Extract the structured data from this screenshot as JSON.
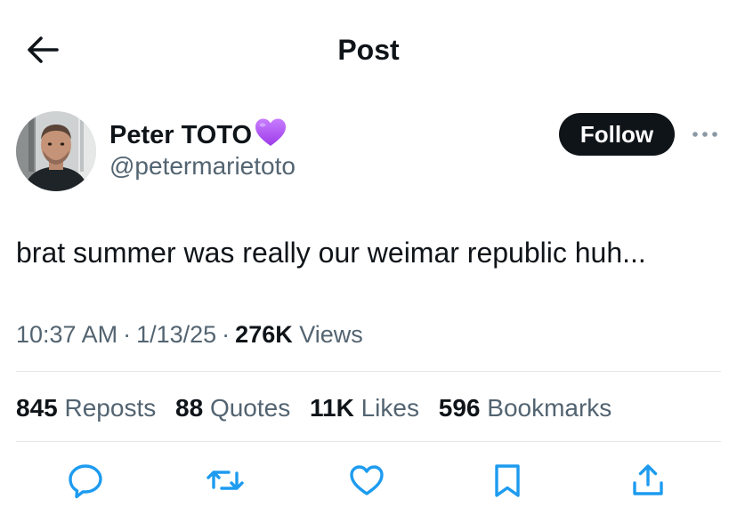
{
  "header": {
    "title": "Post"
  },
  "author": {
    "display_name": "Peter TOTO",
    "handle": "@petermarietoto",
    "badge_emoji": "purple-heart",
    "follow_label": "Follow"
  },
  "tweet": {
    "text": "brat summer was really our weimar republic huh...",
    "time": "10:37 AM",
    "date": "1/13/25",
    "views_count": "276K",
    "views_label": "Views"
  },
  "stats": {
    "reposts": {
      "count": "845",
      "label": "Reposts"
    },
    "quotes": {
      "count": "88",
      "label": "Quotes"
    },
    "likes": {
      "count": "11K",
      "label": "Likes"
    },
    "bookmarks": {
      "count": "596",
      "label": "Bookmarks"
    }
  },
  "actions": [
    "reply-icon",
    "repost-icon",
    "like-icon",
    "bookmark-icon",
    "share-icon"
  ],
  "colors": {
    "text_primary": "#0f1419",
    "text_secondary": "#536471",
    "follow_bg": "#0f1419",
    "heart": "#b35df3",
    "divider": "#e3e6e8"
  }
}
